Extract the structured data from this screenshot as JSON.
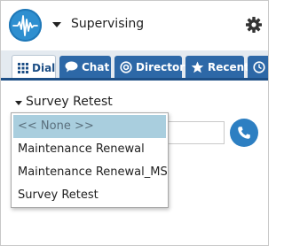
{
  "header": {
    "status_label": "Supervising",
    "logo_icon": "waveform-logo-icon",
    "settings_icon": "gear-icon"
  },
  "tabs": [
    {
      "label": "Dial",
      "icon": "keypad-icon",
      "active": true
    },
    {
      "label": "Chat",
      "icon": "chat-bubble-icon",
      "active": false
    },
    {
      "label": "Directory",
      "icon": "at-sign-icon",
      "active": false
    },
    {
      "label": "Recent",
      "icon": "star-icon",
      "active": false
    },
    {
      "label": "",
      "icon": "clock-icon",
      "active": false
    }
  ],
  "campaign": {
    "selected_label": "Survey Retest"
  },
  "phone": {
    "value": "",
    "call_icon": "phone-icon"
  },
  "dropdown": {
    "options": [
      {
        "label": "<< None >>",
        "highlighted": true
      },
      {
        "label": "Maintenance Renewal",
        "highlighted": false
      },
      {
        "label": "Maintenance Renewal_MS",
        "highlighted": false
      },
      {
        "label": "Survey Retest",
        "highlighted": false
      }
    ]
  },
  "colors": {
    "brand_blue": "#2d68a7",
    "tab_underline": "#1d4f86",
    "option_highlight": "#a9cede",
    "call_button": "#2d7fc2"
  }
}
